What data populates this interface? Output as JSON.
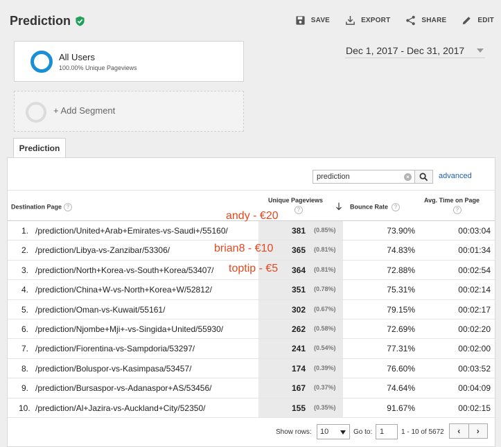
{
  "header": {
    "title": "Prediction",
    "actions": {
      "save": "SAVE",
      "export": "EXPORT",
      "share": "SHARE",
      "edit": "EDIT"
    }
  },
  "segments": {
    "all_users": {
      "name": "All Users",
      "sub": "100.00% Unique Pageviews"
    },
    "add_label": "+ Add Segment"
  },
  "date_range": "Dec 1, 2017 - Dec 31, 2017",
  "tab": "Prediction",
  "search": {
    "value": "prediction",
    "advanced": "advanced"
  },
  "columns": {
    "destination": "Destination Page",
    "unique": "Unique Pageviews",
    "bounce": "Bounce Rate",
    "avg": "Avg. Time on Page"
  },
  "rows": [
    {
      "num": "1.",
      "page": "/prediction/United+Arab+Emirates-vs-Saudi+/55160/",
      "pv": "381",
      "pct": "(0.85%)",
      "bounce": "73.90%",
      "avg": "00:03:04"
    },
    {
      "num": "2.",
      "page": "/prediction/Libya-vs-Zanzibar/53306/",
      "pv": "365",
      "pct": "(0.81%)",
      "bounce": "74.83%",
      "avg": "00:01:34"
    },
    {
      "num": "3.",
      "page": "/prediction/North+Korea-vs-South+Korea/53407/",
      "pv": "364",
      "pct": "(0.81%)",
      "bounce": "72.88%",
      "avg": "00:02:54"
    },
    {
      "num": "4.",
      "page": "/prediction/China+W-vs-North+Korea+W/52812/",
      "pv": "351",
      "pct": "(0.78%)",
      "bounce": "75.31%",
      "avg": "00:02:14"
    },
    {
      "num": "5.",
      "page": "/prediction/Oman-vs-Kuwait/55161/",
      "pv": "302",
      "pct": "(0.67%)",
      "bounce": "79.15%",
      "avg": "00:02:17"
    },
    {
      "num": "6.",
      "page": "/prediction/Njombe+Mji+-vs-Singida+United/55930/",
      "pv": "262",
      "pct": "(0.58%)",
      "bounce": "72.69%",
      "avg": "00:02:20"
    },
    {
      "num": "7.",
      "page": "/prediction/Fiorentina-vs-Sampdoria/53297/",
      "pv": "241",
      "pct": "(0.54%)",
      "bounce": "77.31%",
      "avg": "00:02:00"
    },
    {
      "num": "8.",
      "page": "/prediction/Boluspor-vs-Kasimpasa/53457/",
      "pv": "174",
      "pct": "(0.39%)",
      "bounce": "76.60%",
      "avg": "00:03:52"
    },
    {
      "num": "9.",
      "page": "/prediction/Bursaspor-vs-Adanaspor+AS/53456/",
      "pv": "167",
      "pct": "(0.37%)",
      "bounce": "74.64%",
      "avg": "00:04:09"
    },
    {
      "num": "10.",
      "page": "/prediction/Al+Jazira-vs-Auckland+City/52350/",
      "pv": "155",
      "pct": "(0.35%)",
      "bounce": "91.67%",
      "avg": "00:02:15"
    }
  ],
  "annotations": [
    "andy - €20",
    "brian8  - €10",
    "toptip - €5"
  ],
  "footer": {
    "show_rows_label": "Show rows:",
    "show_rows_value": "10",
    "goto_label": "Go to:",
    "goto_value": "1",
    "range": "1 - 10 of 5672",
    "prev": "‹",
    "next": "›"
  },
  "colors": {
    "accent": "#1a8fd6",
    "badge": "#20a05a",
    "annotation": "#e8471e",
    "link": "#1a5fb4"
  },
  "icons": {
    "verified": "check-shield-icon",
    "save": "floppy-icon",
    "export": "download-icon",
    "share": "share-icon",
    "edit": "pencil-icon",
    "search": "magnifier-icon",
    "sort": "arrow-down-icon"
  }
}
